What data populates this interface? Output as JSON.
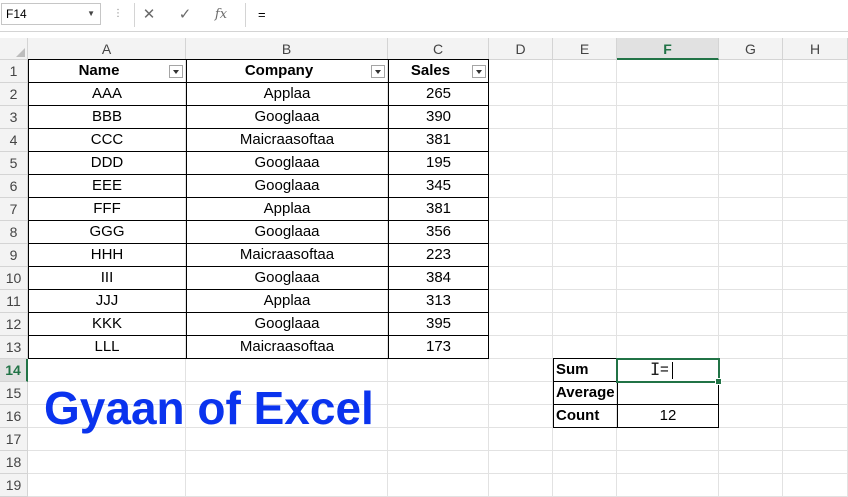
{
  "formula_bar": {
    "name_box": "F14",
    "separator_glyph": "⋮",
    "cancel_glyph": "✕",
    "enter_glyph": "✓",
    "fx_label": "fx",
    "formula": "="
  },
  "columns": [
    "A",
    "B",
    "C",
    "D",
    "E",
    "F",
    "G",
    "H"
  ],
  "rows": [
    "1",
    "2",
    "3",
    "4",
    "5",
    "6",
    "7",
    "8",
    "9",
    "10",
    "11",
    "12",
    "13",
    "14",
    "15",
    "16",
    "17",
    "18",
    "19"
  ],
  "table": {
    "headers": [
      "Name",
      "Company",
      "Sales"
    ],
    "rows": [
      [
        "AAA",
        "Applaa",
        "265"
      ],
      [
        "BBB",
        "Googlaaa",
        "390"
      ],
      [
        "CCC",
        "Maicraasoftaa",
        "381"
      ],
      [
        "DDD",
        "Googlaaa",
        "195"
      ],
      [
        "EEE",
        "Googlaaa",
        "345"
      ],
      [
        "FFF",
        "Applaa",
        "381"
      ],
      [
        "GGG",
        "Googlaaa",
        "356"
      ],
      [
        "HHH",
        "Maicraasoftaa",
        "223"
      ],
      [
        "III",
        "Googlaaa",
        "384"
      ],
      [
        "JJJ",
        "Applaa",
        "313"
      ],
      [
        "KKK",
        "Googlaaa",
        "395"
      ],
      [
        "LLL",
        "Maicraasoftaa",
        "173"
      ]
    ]
  },
  "stats": {
    "labels": [
      "Sum",
      "Average",
      "Count"
    ],
    "values": [
      "=",
      "",
      "12"
    ]
  },
  "brand_text": "Gyaan of Excel",
  "colors": {
    "accent_green": "#217346",
    "brand_blue": "#0a33ee",
    "header_bg": "#f3f3f3"
  }
}
